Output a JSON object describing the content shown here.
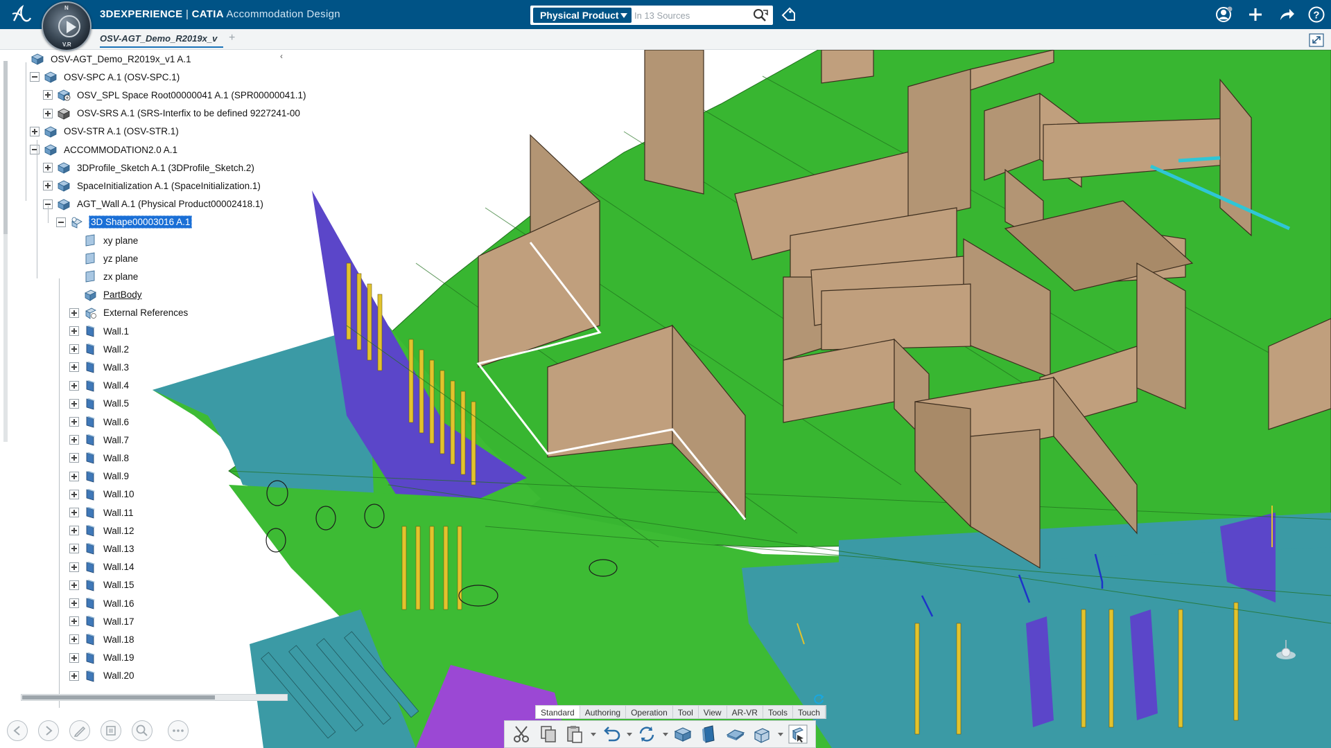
{
  "topbar": {
    "brand": "3DEXPERIENCE",
    "separator": " | ",
    "app": "CATIA",
    "role": "Accommodation Design",
    "compass_north": "N",
    "compass_label": "V.R"
  },
  "search": {
    "scope": "Physical Product",
    "placeholder": "In 13 Sources"
  },
  "tabbar": {
    "document_tab": "OSV-AGT_Demo_R2019x_v",
    "new_tab": "+"
  },
  "tree": {
    "collapse_glyph": "‹",
    "rows": [
      {
        "label": "OSV-AGT_Demo_R2019x_v1 A.1"
      },
      {
        "label": "OSV-SPC A.1 (OSV-SPC.1)"
      },
      {
        "label": "OSV_SPL Space Root00000041 A.1 (SPR00000041.1)"
      },
      {
        "label": "OSV-SRS A.1 (SRS-Interfix to be defined 9227241-00"
      },
      {
        "label": "OSV-STR A.1 (OSV-STR.1)"
      },
      {
        "label": "ACCOMMODATION2.0 A.1"
      },
      {
        "label": "3DProfile_Sketch A.1 (3DProfile_Sketch.2)"
      },
      {
        "label": "SpaceInitialization A.1 (SpaceInitialization.1)"
      },
      {
        "label": "AGT_Wall A.1 (Physical Product00002418.1)"
      },
      {
        "label": "3D Shape00003016 A.1"
      },
      {
        "label": "xy plane"
      },
      {
        "label": "yz plane"
      },
      {
        "label": "zx plane"
      },
      {
        "label": "PartBody"
      },
      {
        "label": "External References"
      },
      {
        "label": "Wall.1"
      },
      {
        "label": "Wall.2"
      },
      {
        "label": "Wall.3"
      },
      {
        "label": "Wall.4"
      },
      {
        "label": "Wall.5"
      },
      {
        "label": "Wall.6"
      },
      {
        "label": "Wall.7"
      },
      {
        "label": "Wall.8"
      },
      {
        "label": "Wall.9"
      },
      {
        "label": "Wall.10"
      },
      {
        "label": "Wall.11"
      },
      {
        "label": "Wall.12"
      },
      {
        "label": "Wall.13"
      },
      {
        "label": "Wall.14"
      },
      {
        "label": "Wall.15"
      },
      {
        "label": "Wall.16"
      },
      {
        "label": "Wall.17"
      },
      {
        "label": "Wall.18"
      },
      {
        "label": "Wall.19"
      },
      {
        "label": "Wall.20"
      }
    ]
  },
  "actionbar": {
    "tabs": [
      "Standard",
      "Authoring",
      "Operation",
      "Tool",
      "View",
      "AR-VR",
      "Tools",
      "Touch"
    ],
    "active_tab": "Standard",
    "tools": [
      "cut-icon",
      "copy-icon",
      "paste-icon",
      "undo-icon",
      "update-icon",
      "physical-product-icon",
      "3d-part-icon",
      "plane-icon",
      "shape-icon",
      "select-icon"
    ]
  },
  "colors": {
    "topbar": "#005386",
    "deck_green": "#38b631",
    "wall_tan": "#b39574",
    "hull_teal": "#3b9aa5",
    "stiffener_yellow": "#e2c32d",
    "purple": "#5b46c9",
    "selection_blue": "#1a6fd6"
  }
}
